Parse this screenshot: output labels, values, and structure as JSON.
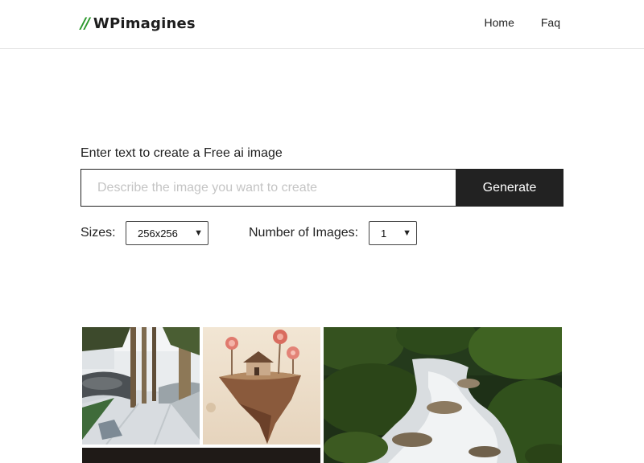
{
  "header": {
    "logo_mark": "//",
    "logo_text": "WPimagines",
    "nav": [
      {
        "label": "Home"
      },
      {
        "label": "Faq"
      }
    ]
  },
  "generator": {
    "label": "Enter text to create a Free ai image",
    "placeholder": "Describe the image you want to create",
    "value": "",
    "button_label": "Generate"
  },
  "options": {
    "sizes_label": "Sizes:",
    "sizes_selected": "256x256",
    "count_label": "Number of Images:",
    "count_selected": "1"
  },
  "gallery": {
    "images": [
      {
        "subject": "modern courtyard with trees"
      },
      {
        "subject": "floating island with house and lollipop trees"
      },
      {
        "subject": "forest stream waterfall"
      },
      {
        "subject": "dark image"
      }
    ]
  },
  "colors": {
    "accent": "#2e9a2e",
    "button_bg": "#222222",
    "border": "#e3e3e3"
  }
}
